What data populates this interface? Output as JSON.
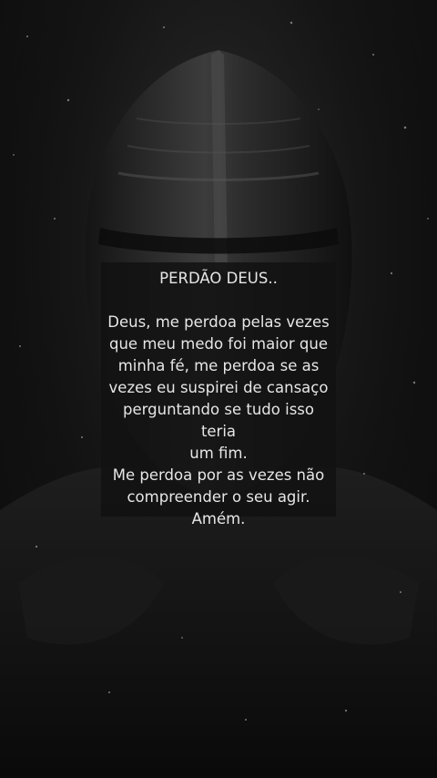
{
  "card": {
    "title": "PERDÃO DEUS..",
    "lines": [
      "Deus, me perdoa pelas vezes",
      "que meu medo foi maior que",
      "minha fé, me perdoa se as",
      "vezes eu suspirei de cansaço",
      "perguntando se tudo isso teria",
      "um fim.",
      "Me perdoa por as vezes não",
      "compreender o seu agir.",
      "Amém."
    ]
  },
  "colors": {
    "background": "#0b0b0b",
    "text": "#e6e6e6",
    "box": "#121212"
  }
}
